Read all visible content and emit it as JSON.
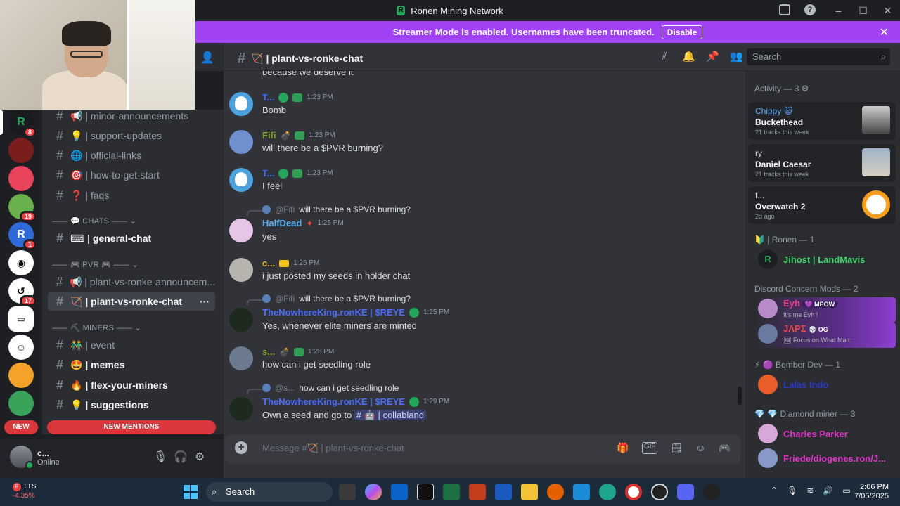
{
  "app": {
    "title": "Ronen Mining Network"
  },
  "banner": {
    "text": "Streamer Mode is enabled. Usernames have been truncated.",
    "button": "Disable"
  },
  "servers": [
    {
      "label": "R",
      "color": "#23a55a",
      "badge": "8"
    },
    {
      "label": "",
      "color": "#7a1d1d",
      "badge": ""
    },
    {
      "label": "",
      "color": "#e8455c",
      "badge": ""
    },
    {
      "label": "",
      "color": "#6ab04c",
      "badge": "19"
    },
    {
      "label": "R",
      "color": "#2e6bd8",
      "badge": "1"
    },
    {
      "label": "",
      "color": "#ffffff",
      "badge": ""
    },
    {
      "label": "",
      "color": "#ffffff",
      "badge": "17"
    },
    {
      "label": "",
      "color": "#ffffff",
      "badge": ""
    },
    {
      "label": "",
      "color": "#ffffff",
      "badge": ""
    },
    {
      "label": "",
      "color": "#f4a328",
      "badge": ""
    },
    {
      "label": "",
      "color": "#3aa35a",
      "badge": ""
    }
  ],
  "channels": [
    {
      "label": "📢 | minor-announcements",
      "state": ""
    },
    {
      "label": "💡 | support-updates",
      "state": ""
    },
    {
      "label": "🌐 | official-links",
      "state": ""
    },
    {
      "label": "🎯 | how-to-get-start",
      "state": ""
    },
    {
      "label": "❓ | faqs",
      "state": ""
    },
    {
      "label": "⌨ | general-chat",
      "state": "unread"
    },
    {
      "label": "📢 | plant-vs-ronke-announcem...",
      "state": ""
    },
    {
      "label": "🏹 | plant-vs-ronke-chat",
      "state": "active"
    },
    {
      "label": "👬 | event",
      "state": ""
    },
    {
      "label": "🤩 | memes",
      "state": "unread"
    },
    {
      "label": "🔥 | flex-your-miners",
      "state": "unread"
    },
    {
      "label": "💡 | suggestions",
      "state": "unread"
    }
  ],
  "categories": {
    "chats": "—— 💬 CHATS —— ⌄",
    "pvr": "—— 🎮 PVR 🎮 —— ⌄",
    "miners": "—— ⛏ MINERS —— ⌄"
  },
  "new_label": "NEW",
  "new_mentions": "NEW MENTIONS",
  "user": {
    "name": "c...",
    "status": "Online"
  },
  "header": {
    "channel": "🏹 | plant-vs-ronke-chat",
    "search_placeholder": "Search"
  },
  "messages": {
    "partial": "because we deserve it",
    "m1": {
      "user": "T...",
      "time": "1:23 PM",
      "text": "Bomb"
    },
    "m2": {
      "user": "Fifi",
      "time": "1:23 PM",
      "text": "will there be a $PVR burning?"
    },
    "m3": {
      "user": "T...",
      "time": "1:23 PM",
      "text": "I feel"
    },
    "m4": {
      "reply_user": "@Fifi",
      "reply_text": "will there be a $PVR burning?",
      "user": "HalfDead",
      "time": "1:25 PM",
      "text": "yes"
    },
    "m5": {
      "user": "c...",
      "time": "1:25 PM",
      "text": "i just posted my seeds in holder chat"
    },
    "m6": {
      "reply_user": "@Fifi",
      "reply_text": "will there be a $PVR burning?",
      "user": "TheNowhereKing.ronKE | $REYE",
      "time": "1:25 PM",
      "text": "Yes, whenever elite miners are minted"
    },
    "m7": {
      "user": "s...",
      "time": "1:28 PM",
      "text": "how can i get seedling role"
    },
    "m8": {
      "reply_user": "@s...",
      "reply_text": "how can i get seedling role",
      "user": "TheNowhereKing.ronKE | $REYE",
      "time": "1:29 PM",
      "text_prefix": "Own a seed and go to",
      "channel_mention": "# 🤖 | collabland"
    }
  },
  "composer": {
    "placeholder": "Message #🏹 | plant-vs-ronke-chat"
  },
  "members": {
    "activity_header": "Activity — 3 ⚙",
    "activities": [
      {
        "user": "Chippy 😺",
        "title": "Buckethead",
        "sub": "21 tracks this week",
        "user_color": "#5ca8f5"
      },
      {
        "user": "ry",
        "title": "Daniel Caesar",
        "sub": "21 tracks this week",
        "user_color": "#dbdee1"
      },
      {
        "user": "f...",
        "title": "Overwatch 2",
        "sub": "2d ago",
        "user_color": "#dbdee1"
      }
    ],
    "ronen_header": "🔰 | Ronen — 1",
    "ronen_member": "Jihost | LandMavis",
    "mods_header": "Discord Concern Mods — 2",
    "mods": [
      {
        "name": "Eyh",
        "tag": "💜 MEOW",
        "status": "It's me Eyh !"
      },
      {
        "name": "JΛPΣ",
        "tag": "💀 OG",
        "status": "🖼 Focus on What Matt..."
      }
    ],
    "bomber_header": "⚡ 🟣 Bomber Dev — 1",
    "bomber_member": "Lalas Indo",
    "diamond_header": "💎 💎 Diamond miner — 3",
    "diamond_members": [
      "Charles Parker",
      "Friede/diogenes.ron/J..."
    ]
  },
  "taskbar": {
    "stock_name": "TTS",
    "stock_change": "-4.35%",
    "stock_badge": "8",
    "search": "Search",
    "time": "2:06 PM",
    "date": "7/05/2025"
  }
}
